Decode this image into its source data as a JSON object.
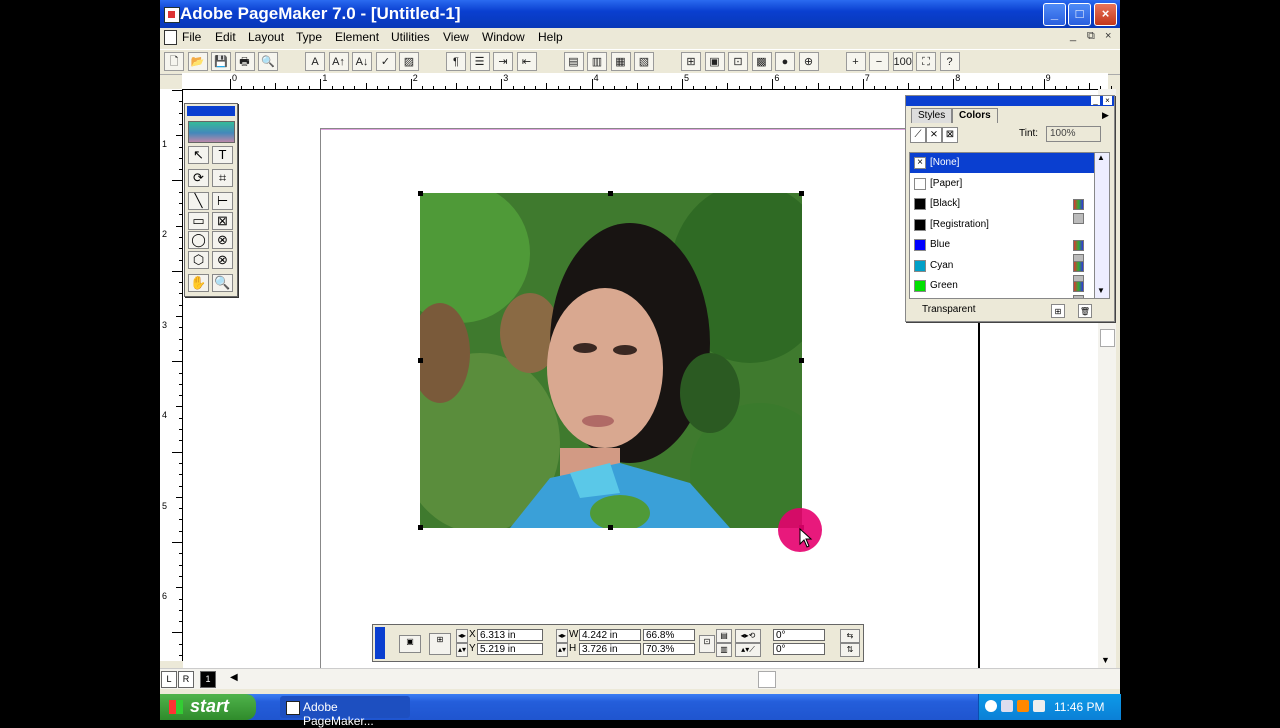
{
  "window": {
    "title": "Adobe PageMaker 7.0 - [Untitled-1]"
  },
  "title_buttons": {
    "minimize": "_",
    "maximize": "□",
    "close": "×"
  },
  "menu": [
    "File",
    "Edit",
    "Layout",
    "Type",
    "Element",
    "Utilities",
    "View",
    "Window",
    "Help"
  ],
  "mdi_controls": [
    "_",
    "⧉",
    "×"
  ],
  "toolbar_icons": [
    "new-icon",
    "open-icon",
    "save-icon",
    "print-icon",
    "find-icon",
    "type-A-icon",
    "font-size-up-icon",
    "font-size-down-icon",
    "spell-icon",
    "fill-icon",
    "paragraph-icon",
    "bullets-icon",
    "indent-icon",
    "outdent-icon",
    "styles-icon",
    "colors-icon",
    "control-palette-icon",
    "library-icon",
    "plugin-icon",
    "image-icon",
    "crop-icon",
    "picture-icon",
    "globe-icon",
    "hyperlink-icon",
    "zoom-in-icon",
    "zoom-out-icon",
    "actual-size-icon",
    "fit-icon",
    "help-icon"
  ],
  "toolbar_glyphs": [
    "🗋",
    "📂",
    "💾",
    "🖶",
    "🔍",
    "A",
    "A↑",
    "A↓",
    "✓",
    "▨",
    "¶",
    "☰",
    "⇥",
    "⇤",
    "▤",
    "▥",
    "▦",
    "▧",
    "⊞",
    "▣",
    "⊡",
    "▩",
    "●",
    "⊕",
    "+",
    "−",
    "100",
    "⛶",
    "?"
  ],
  "hruler_numbers": [
    "0",
    "1",
    "2",
    "3",
    "4",
    "5",
    "6",
    "7",
    "8",
    "9"
  ],
  "vruler_numbers": [
    "1",
    "2",
    "3",
    "4",
    "5",
    "6"
  ],
  "toolbox": {
    "tools": [
      "arrow",
      "text",
      "rotate",
      "crop",
      "line",
      "constrained-line",
      "rectangle",
      "rectangle-frame",
      "ellipse",
      "ellipse-frame",
      "polygon",
      "polygon-frame",
      "hand",
      "zoom"
    ],
    "glyphs": [
      "↖",
      "T",
      "⟳",
      "⌗",
      "╲",
      "⊢",
      "▭",
      "⊠",
      "◯",
      "⊗",
      "⬡",
      "⊗",
      "✋",
      "🔍"
    ]
  },
  "colors_panel": {
    "tabs": [
      "Styles",
      "Colors"
    ],
    "active_tab": "Colors",
    "tint_label": "Tint:",
    "tint_value": "100%",
    "fill_buttons": [
      "⟋",
      "⨯",
      "⊠"
    ],
    "colors": [
      {
        "name": "[None]",
        "swatch": "#ffffff",
        "selected": true,
        "icons": false
      },
      {
        "name": "[Paper]",
        "swatch": "#ffffff",
        "selected": false,
        "icons": false
      },
      {
        "name": "[Black]",
        "swatch": "#000000",
        "selected": false,
        "icons": true
      },
      {
        "name": "[Registration]",
        "swatch": "#000000",
        "selected": false,
        "icons": false
      },
      {
        "name": "Blue",
        "swatch": "#0000ff",
        "selected": false,
        "icons": true
      },
      {
        "name": "Cyan",
        "swatch": "#00a0c8",
        "selected": false,
        "icons": true
      },
      {
        "name": "Green",
        "swatch": "#00e000",
        "selected": false,
        "icons": true
      }
    ],
    "footer": "Transparent"
  },
  "control_palette": {
    "x_label": "X",
    "y_label": "Y",
    "w_label": "W",
    "h_label": "H",
    "x": "6.313 in",
    "y": "5.219 in",
    "w": "4.242 in",
    "h": "3.726 in",
    "scale_w": "66.8%",
    "scale_h": "70.3%",
    "rotate": "0°",
    "skew": "0°"
  },
  "page_tabs": [
    "L",
    "R",
    "1"
  ],
  "taskbar": {
    "start": "start",
    "task": "Adobe PageMaker...",
    "clock": "11:46 PM"
  },
  "colors": {
    "titlebar": "#0a3fd0",
    "selection": "#0a3fd0",
    "cursor_highlight": "#e6006e"
  }
}
